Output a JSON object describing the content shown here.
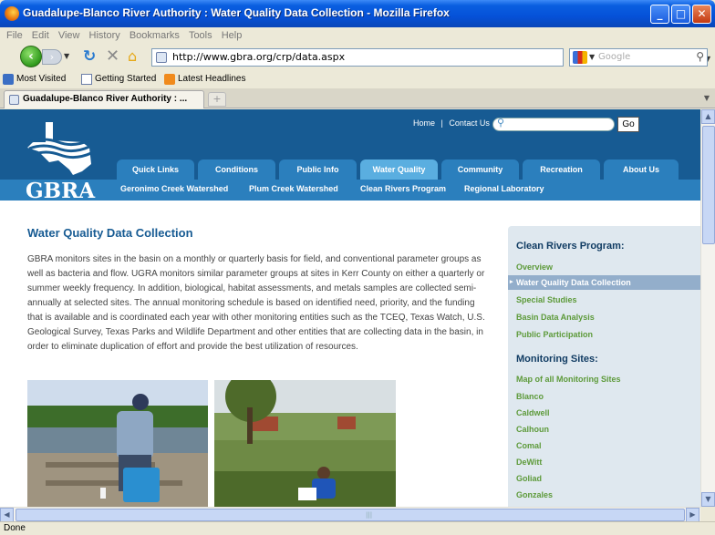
{
  "window": {
    "title": "Guadalupe-Blanco River Authority : Water Quality Data Collection - Mozilla Firefox",
    "minimize": "_",
    "maximize": "□",
    "close": "✕"
  },
  "menu": [
    "File",
    "Edit",
    "View",
    "History",
    "Bookmarks",
    "Tools",
    "Help"
  ],
  "toolbar": {
    "url": "http://www.gbra.org/crp/data.aspx",
    "search_placeholder": "Google"
  },
  "bookmarks": [
    "Most Visited",
    "Getting Started",
    "Latest Headlines"
  ],
  "tab": {
    "label": "Guadalupe-Blanco River Authority : ...",
    "new_tab": "+"
  },
  "site": {
    "logo": "GBRA",
    "top_links": [
      "Home",
      "|",
      "Contact Us"
    ],
    "go_button": "Go",
    "main_tabs": [
      "Quick Links",
      "Conditions",
      "Public Info",
      "Water Quality",
      "Community",
      "Recreation",
      "About Us"
    ],
    "active_tab": "Water Quality",
    "sub_links": [
      "Geronimo Creek Watershed",
      "Plum Creek Watershed",
      "Clean Rivers Program",
      "Regional Laboratory"
    ]
  },
  "content": {
    "title": "Water Quality Data Collection",
    "body": "GBRA monitors sites in the basin on a monthly or quarterly basis for field, and conventional parameter groups as well as bacteria and flow. UGRA monitors similar parameter groups at sites in Kerr County on either a quarterly or summer weekly frequency. In addition, biological, habitat assessments, and metals samples are collected semi-annually at selected sites. The annual monitoring schedule is based on identified need, priority, and the funding that is available and is coordinated each year with other monitoring entities such as the TCEQ, Texas Watch, U.S. Geological Survey, Texas Parks and Wildlife Department and other entities that are collecting data in the basin, in order to eliminate duplication of effort and provide the best utilization of resources."
  },
  "sidebar": {
    "heading1": "Clean Rivers Program:",
    "items1": [
      "Overview",
      "Water Quality Data Collection",
      "Special Studies",
      "Basin Data Analysis",
      "Public Participation"
    ],
    "active_item": "Water Quality Data Collection",
    "heading2": "Monitoring Sites:",
    "items2": [
      "Map of all Monitoring Sites",
      "Blanco",
      "Caldwell",
      "Calhoun",
      "Comal",
      "DeWitt",
      "Goliad",
      "Gonzales"
    ]
  },
  "status": "Done",
  "colors": {
    "header_blue": "#175b93",
    "tab_blue": "#2b7fbd",
    "active_tab": "#5aaee0",
    "sidebar_link_green": "#5d9a3a",
    "sidebar_bg": "#dfe8ef"
  }
}
